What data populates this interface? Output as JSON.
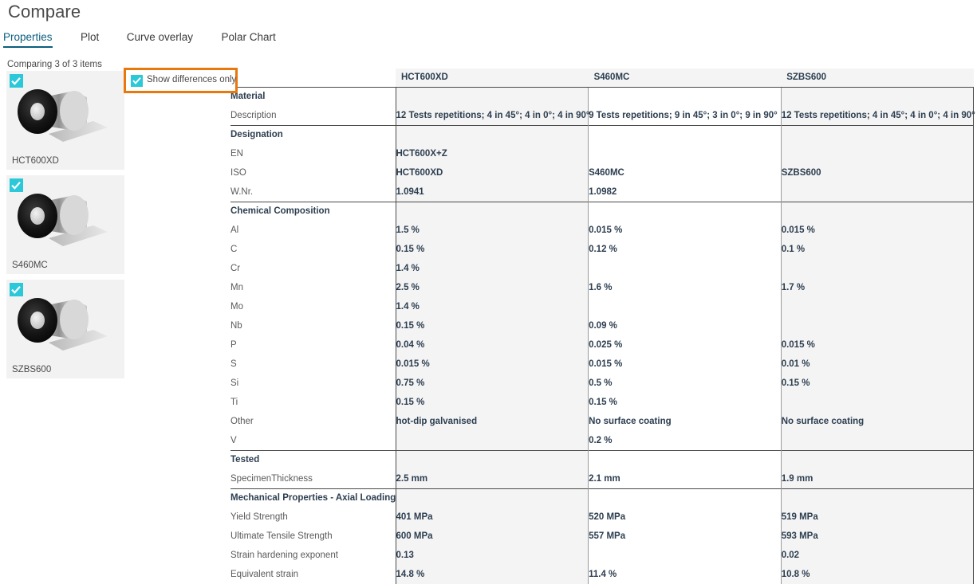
{
  "page": {
    "title": "Compare",
    "comparing_text": "Comparing 3 of 3 items"
  },
  "tabs": [
    {
      "label": "Properties",
      "active": true
    },
    {
      "label": "Plot",
      "active": false
    },
    {
      "label": "Curve overlay",
      "active": false
    },
    {
      "label": "Polar Chart",
      "active": false
    }
  ],
  "options": {
    "show_differences_only_label": "Show differences only",
    "show_differences_only_checked": true,
    "highlight_color": "#e8780c"
  },
  "items": [
    {
      "label": "HCT600XD",
      "checked": true,
      "thumbnail": "steel-coil-image"
    },
    {
      "label": "S460MC",
      "checked": true,
      "thumbnail": "steel-coil-image"
    },
    {
      "label": "SZBS600",
      "checked": true,
      "thumbnail": "steel-coil-image"
    }
  ],
  "table": {
    "property_header": "",
    "columns": [
      "HCT600XD",
      "S460MC",
      "SZBS600"
    ],
    "sections": [
      {
        "group": "Material",
        "rows": [
          {
            "label": "Description",
            "values": [
              "12 Tests repetitions; 4 in 45°; 4 in 0°; 4 in 90°",
              "9 Tests repetitions; 9 in 45°; 3 in 0°; 9 in 90°",
              "12 Tests repetitions; 4 in 45°; 4 in 0°; 4 in 90°"
            ]
          }
        ]
      },
      {
        "group": "Designation",
        "rows": [
          {
            "label": "EN",
            "values": [
              "HCT600X+Z",
              "",
              ""
            ]
          },
          {
            "label": "ISO",
            "values": [
              "HCT600XD",
              "S460MC",
              "SZBS600"
            ]
          },
          {
            "label": "W.Nr.",
            "values": [
              "1.0941",
              "1.0982",
              ""
            ]
          }
        ]
      },
      {
        "group": "Chemical Composition",
        "rows": [
          {
            "label": "Al",
            "values": [
              "1.5 %",
              "0.015 %",
              "0.015 %"
            ]
          },
          {
            "label": "C",
            "values": [
              "0.15 %",
              "0.12 %",
              "0.1 %"
            ]
          },
          {
            "label": "Cr",
            "values": [
              "1.4 %",
              "",
              ""
            ]
          },
          {
            "label": "Mn",
            "values": [
              "2.5 %",
              "1.6 %",
              "1.7 %"
            ]
          },
          {
            "label": "Mo",
            "values": [
              "1.4 %",
              "",
              ""
            ]
          },
          {
            "label": "Nb",
            "values": [
              "0.15 %",
              "0.09 %",
              ""
            ]
          },
          {
            "label": "P",
            "values": [
              "0.04 %",
              "0.025 %",
              "0.015 %"
            ]
          },
          {
            "label": "S",
            "values": [
              "0.015 %",
              "0.015 %",
              "0.01 %"
            ]
          },
          {
            "label": "Si",
            "values": [
              "0.75 %",
              "0.5 %",
              "0.15 %"
            ]
          },
          {
            "label": "Ti",
            "values": [
              "0.15 %",
              "0.15 %",
              ""
            ]
          },
          {
            "label": "Other",
            "values": [
              "hot-dip galvanised",
              "No surface coating",
              "No surface coating"
            ]
          },
          {
            "label": "V",
            "values": [
              "",
              "0.2 %",
              ""
            ]
          }
        ]
      },
      {
        "group": "Tested",
        "rows": [
          {
            "label": "SpecimenThickness",
            "values": [
              "2.5 mm",
              "2.1 mm",
              "1.9 mm"
            ]
          }
        ]
      },
      {
        "group": "Mechanical Properties - Axial Loading",
        "rows": [
          {
            "label": "Yield Strength",
            "values": [
              "401 MPa",
              "520 MPa",
              "519 MPa"
            ]
          },
          {
            "label": "Ultimate Tensile Strength",
            "values": [
              "600 MPa",
              "557 MPa",
              "593 MPa"
            ]
          },
          {
            "label": "Strain hardening exponent",
            "values": [
              "0.13",
              "",
              "0.02"
            ]
          },
          {
            "label": "Equivalent strain",
            "values": [
              "14.8 %",
              "11.4 %",
              "10.8 %"
            ]
          }
        ]
      }
    ]
  }
}
